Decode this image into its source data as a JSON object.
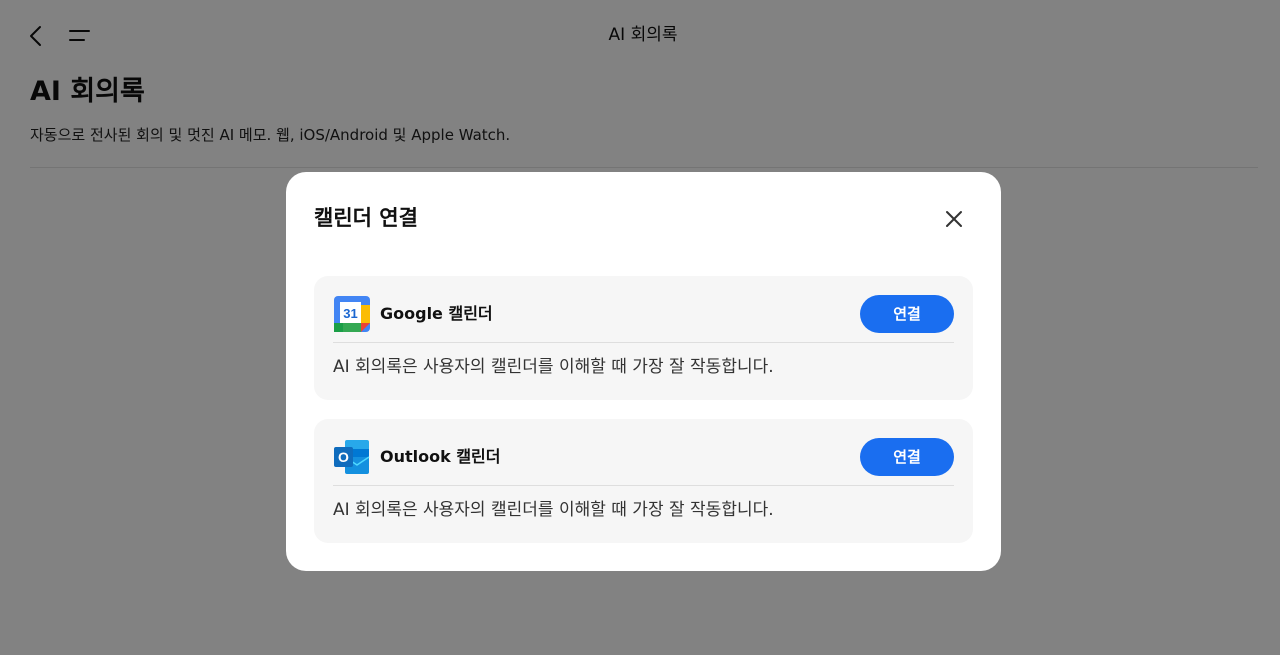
{
  "header": {
    "title": "AI 회의록",
    "back_icon": "chevron-left-icon",
    "menu_icon": "menu-icon"
  },
  "page": {
    "title": "AI 회의록",
    "subtitle": "자동으로 전사된 회의 및 멋진 AI 메모. 웹, iOS/Android 및 Apple Watch."
  },
  "modal": {
    "title": "캘린더 연결",
    "close_icon": "close-icon",
    "cards": [
      {
        "icon": "google-calendar-icon",
        "icon_text": "31",
        "name": "Google 캘린더",
        "button_label": "연결",
        "description": "AI 회의록은 사용자의 캘린더를 이해할 때 가장 잘 작동합니다."
      },
      {
        "icon": "outlook-icon",
        "icon_text": "O",
        "name": "Outlook 캘린더",
        "button_label": "연결",
        "description": "AI 회의록은 사용자의 캘린더를 이해할 때 가장 잘 작동합니다."
      }
    ]
  },
  "colors": {
    "accent": "#1a6ef0",
    "overlay": "rgba(0,0,0,0.49)",
    "card_bg": "#f6f6f6"
  }
}
